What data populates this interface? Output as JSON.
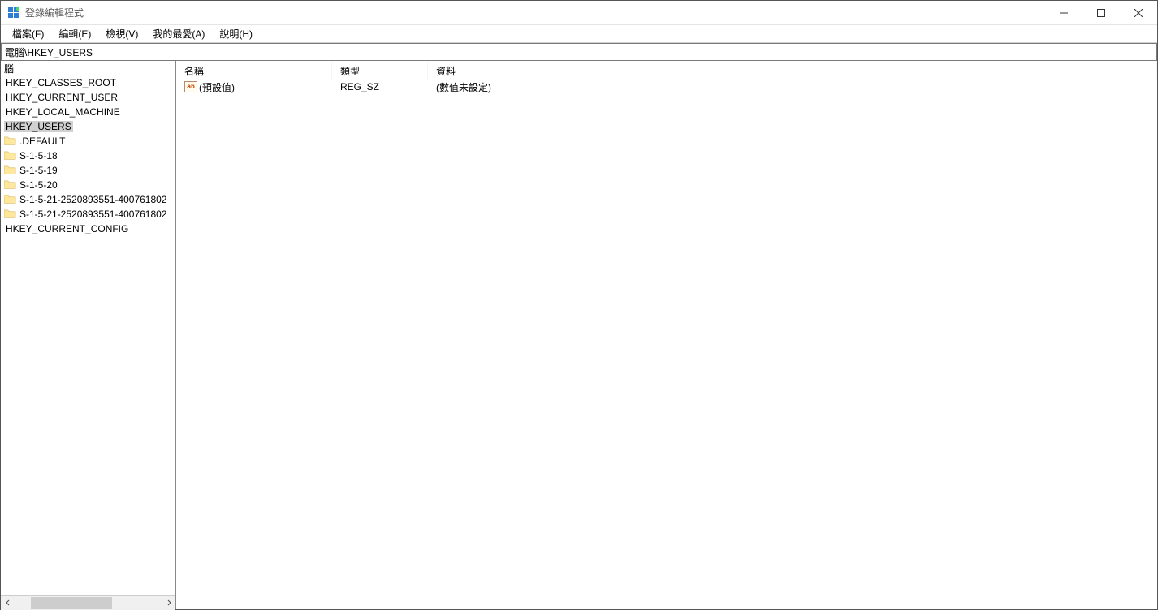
{
  "window": {
    "title": "登錄編輯程式"
  },
  "menu": {
    "file": "檔案(F)",
    "edit": "編輯(E)",
    "view": "檢視(V)",
    "favorites": "我的最愛(A)",
    "help": "說明(H)"
  },
  "address": "電腦\\HKEY_USERS",
  "tree": {
    "root": "腦",
    "hives": [
      "HKEY_CLASSES_ROOT",
      "HKEY_CURRENT_USER",
      "HKEY_LOCAL_MACHINE",
      "HKEY_USERS",
      "HKEY_CURRENT_CONFIG"
    ],
    "users_children": [
      ".DEFAULT",
      "S-1-5-18",
      "S-1-5-19",
      "S-1-5-20",
      "S-1-5-21-2520893551-400761802",
      "S-1-5-21-2520893551-400761802"
    ]
  },
  "list": {
    "headers": {
      "name": "名稱",
      "type": "類型",
      "data": "資料"
    },
    "rows": [
      {
        "name": "(預設值)",
        "type": "REG_SZ",
        "data": "(數值未設定)"
      }
    ]
  },
  "icons": {
    "value_glyph": "ab"
  }
}
